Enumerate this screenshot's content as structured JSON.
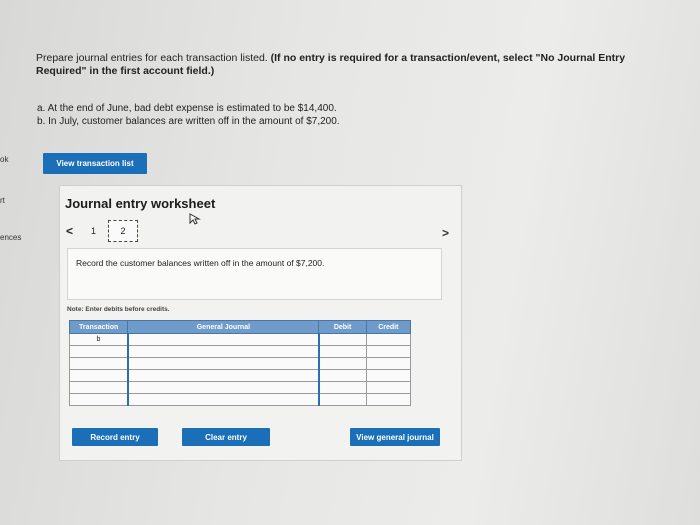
{
  "sidebar_fragments": [
    "ok",
    "rt",
    "ences"
  ],
  "instructions": {
    "text": "Prepare journal entries for each transaction listed. ",
    "bold": "(If no entry is required for a transaction/event, select \"No Journal Entry Required\" in the first account field.)"
  },
  "items": [
    "a. At the end of June, bad debt expense is estimated to be $14,400.",
    "b. In July, customer balances are written off in the amount of $7,200."
  ],
  "view_transaction_list": "View transaction list",
  "worksheet": {
    "title": "Journal entry worksheet",
    "pager": {
      "prev": "<",
      "page1": "1",
      "page2": "2",
      "next": ">"
    },
    "description": "Record the customer balances written off in the amount of $7,200.",
    "note": "Note: Enter debits before credits.",
    "columns": [
      "Transaction",
      "General Journal",
      "Debit",
      "Credit"
    ],
    "rows": [
      {
        "transaction": "b"
      },
      {
        "transaction": ""
      },
      {
        "transaction": ""
      },
      {
        "transaction": ""
      },
      {
        "transaction": ""
      },
      {
        "transaction": ""
      }
    ],
    "record_entry": "Record entry",
    "clear_entry": "Clear entry",
    "view_general_journal": "View general journal"
  },
  "colors": {
    "button_blue": "#1a6fb8",
    "header_blue": "#6e9bc9"
  }
}
